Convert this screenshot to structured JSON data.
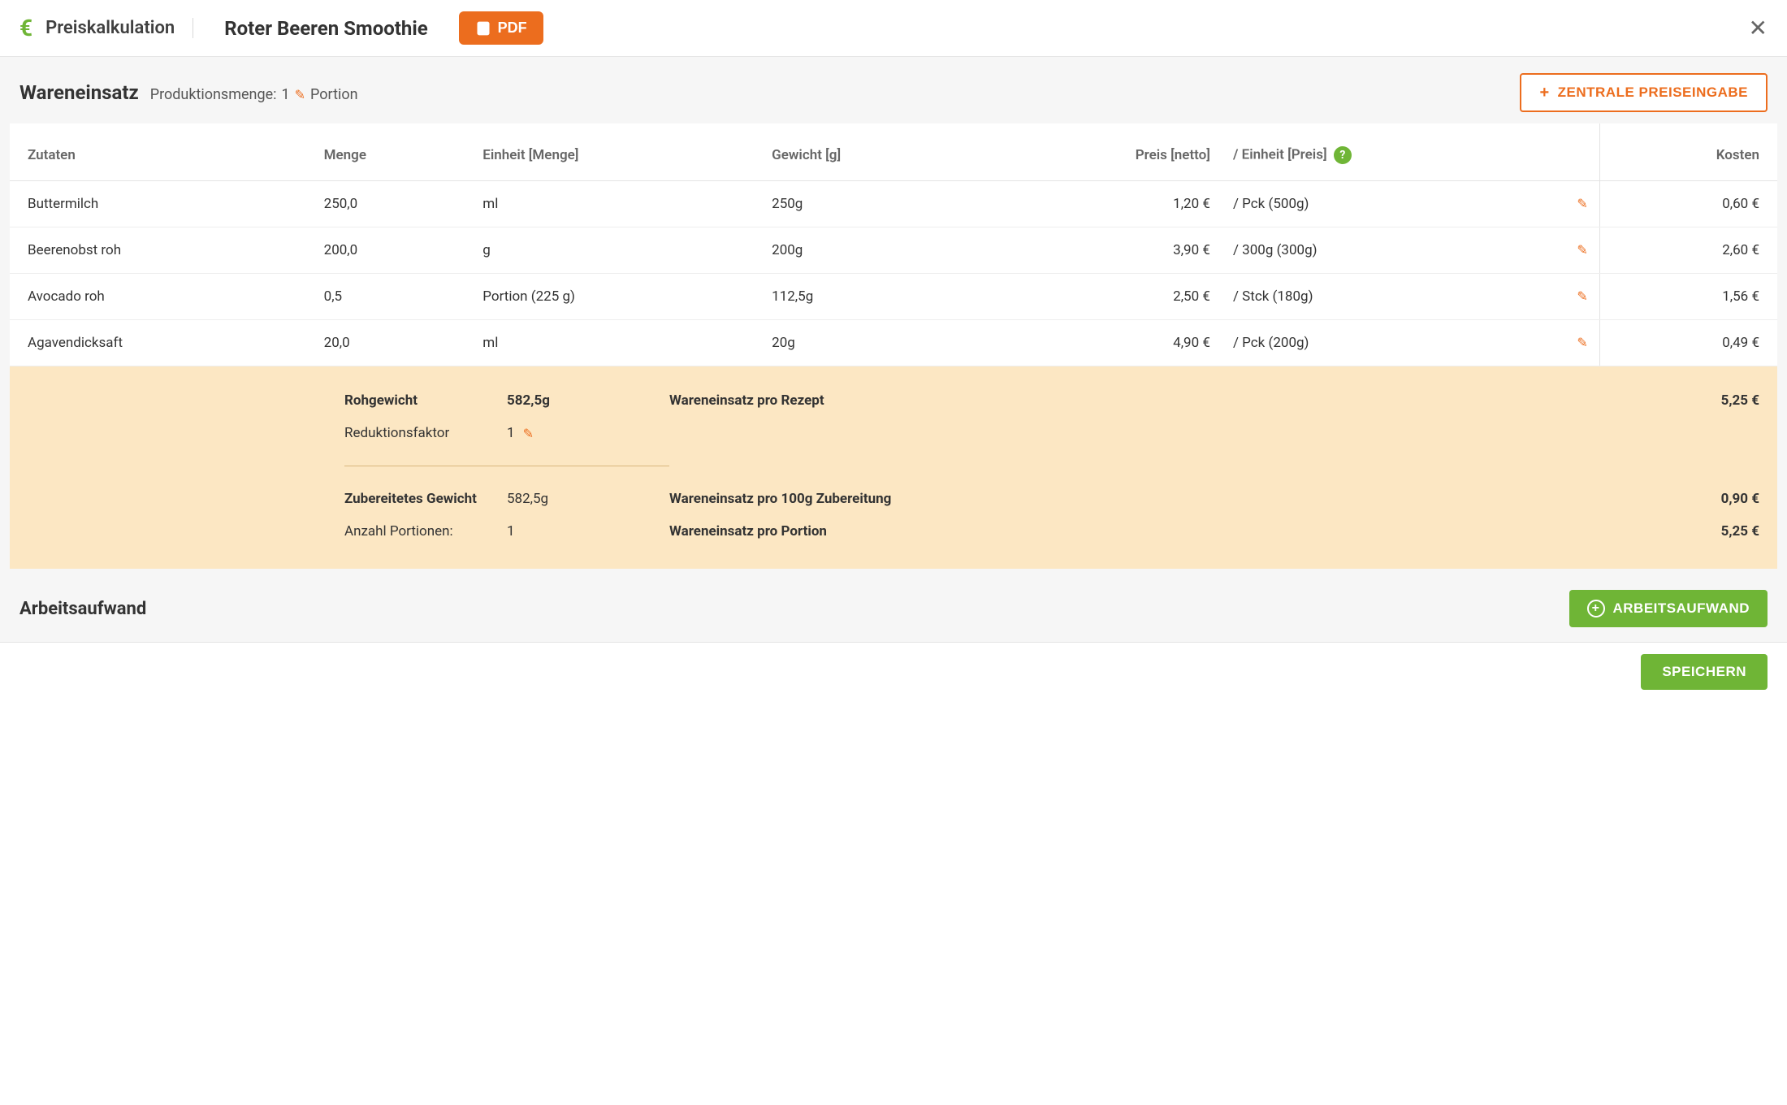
{
  "header": {
    "module_title": "Preiskalkulation",
    "recipe_name": "Roter Beeren Smoothie",
    "pdf_label": "PDF"
  },
  "section": {
    "title": "Wareneinsatz",
    "prod_qty_label": "Produktionsmenge:",
    "prod_qty_value": "1",
    "prod_qty_unit": "Portion",
    "central_price_label": "ZENTRALE PREISEINGABE"
  },
  "table": {
    "headers": {
      "zutaten": "Zutaten",
      "menge": "Menge",
      "einheit_menge": "Einheit [Menge]",
      "gewicht": "Gewicht [g]",
      "preis_netto": "Preis [netto]",
      "einheit_preis": "/ Einheit [Preis]",
      "kosten": "Kosten"
    },
    "rows": [
      {
        "zutat": "Buttermilch",
        "menge": "250,0",
        "einheit": "ml",
        "gewicht": "250g",
        "preis": "1,20 €",
        "einheit_preis": "/ Pck (500g)",
        "kosten": "0,60 €"
      },
      {
        "zutat": "Beerenobst roh",
        "menge": "200,0",
        "einheit": "g",
        "gewicht": "200g",
        "preis": "3,90 €",
        "einheit_preis": "/ 300g (300g)",
        "kosten": "2,60 €"
      },
      {
        "zutat": "Avocado roh",
        "menge": "0,5",
        "einheit": "Portion (225 g)",
        "gewicht": "112,5g",
        "preis": "2,50 €",
        "einheit_preis": "/ Stck (180g)",
        "kosten": "1,56 €"
      },
      {
        "zutat": "Agavendicksaft",
        "menge": "20,0",
        "einheit": "ml",
        "gewicht": "20g",
        "preis": "4,90 €",
        "einheit_preis": "/ Pck (200g)",
        "kosten": "0,49 €"
      }
    ]
  },
  "summary": {
    "rohgewicht_label": "Rohgewicht",
    "rohgewicht_value": "582,5g",
    "wareneinsatz_rezept_label": "Wareneinsatz pro Rezept",
    "wareneinsatz_rezept_value": "5,25 €",
    "reduktion_label": "Reduktionsfaktor",
    "reduktion_value": "1",
    "zubereitet_label": "Zubereitetes Gewicht",
    "zubereitet_value": "582,5g",
    "wareneinsatz_100g_label": "Wareneinsatz pro 100g Zubereitung",
    "wareneinsatz_100g_value": "0,90 €",
    "portionen_label": "Anzahl Portionen:",
    "portionen_value": "1",
    "wareneinsatz_portion_label": "Wareneinsatz pro Portion",
    "wareneinsatz_portion_value": "5,25 €"
  },
  "work": {
    "title": "Arbeitsaufwand",
    "button_label": "ARBEITSAUFWAND"
  },
  "footer": {
    "save_label": "SPEICHERN"
  }
}
